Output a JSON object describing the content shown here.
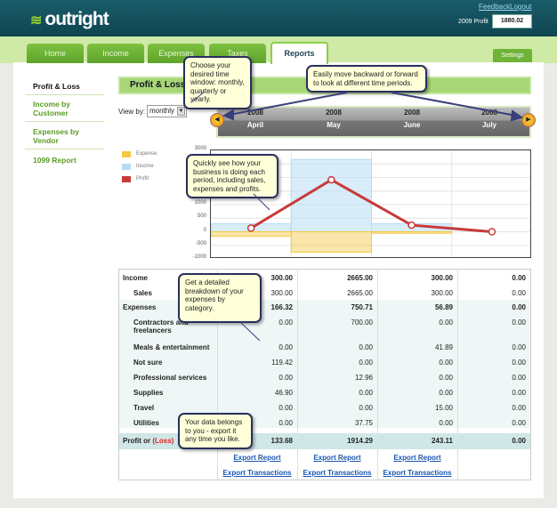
{
  "header": {
    "logo": "outright",
    "feedback": "Feedback",
    "logout": "Logout",
    "profit_label": "2009 Profit",
    "profit_value": "1880.02"
  },
  "tabs": [
    "Home",
    "Income",
    "Expenses",
    "Taxes",
    "Reports"
  ],
  "settings": "Settings",
  "sidebar": [
    "Profit & Loss",
    "Income by Customer",
    "Expenses by Vendor",
    "1099 Report"
  ],
  "main": {
    "title": "Profit & Loss",
    "view_by_label": "View by:",
    "view_by_value": "monthly"
  },
  "periods": [
    {
      "year": "2008",
      "month": "April"
    },
    {
      "year": "2008",
      "month": "May"
    },
    {
      "year": "2008",
      "month": "June"
    },
    {
      "year": "2008",
      "month": "July"
    }
  ],
  "chart_data": {
    "type": "bar+line",
    "legend": [
      "Expense",
      "Income",
      "Profit"
    ],
    "categories": [
      "April",
      "May",
      "June",
      "July"
    ],
    "yticks": [
      "3000",
      "2500",
      "2000",
      "1500",
      "1000",
      "500",
      "0",
      "-500",
      "-1000"
    ],
    "ylim": [
      -1000,
      3000
    ],
    "series": [
      {
        "name": "Income",
        "values": [
          300,
          2665,
          300,
          0
        ]
      },
      {
        "name": "Expense",
        "values": [
          -166.32,
          -750.71,
          -56.89,
          0
        ]
      },
      {
        "name": "Profit",
        "values": [
          133.68,
          1914.29,
          243.11,
          0
        ]
      }
    ],
    "colors": {
      "Expense": "#f5c842",
      "Income": "#b8dcf5",
      "Profit": "#c83a3a"
    }
  },
  "table": {
    "rows": [
      {
        "label": "Income",
        "values": [
          "300.00",
          "2665.00",
          "300.00",
          "0.00"
        ],
        "type": "head"
      },
      {
        "label": "Sales",
        "values": [
          "300.00",
          "2665.00",
          "300.00",
          "0.00"
        ],
        "type": "sub"
      },
      {
        "label": "Expenses",
        "values": [
          "166.32",
          "750.71",
          "56.89",
          "0.00"
        ],
        "type": "head"
      },
      {
        "label": "Contractors and freelancers",
        "values": [
          "0.00",
          "700.00",
          "0.00",
          "0.00"
        ],
        "type": "sub"
      },
      {
        "label": "Meals & entertainment",
        "values": [
          "0.00",
          "0.00",
          "41.89",
          "0.00"
        ],
        "type": "sub"
      },
      {
        "label": "Not sure",
        "values": [
          "119.42",
          "0.00",
          "0.00",
          "0.00"
        ],
        "type": "sub"
      },
      {
        "label": "Professional services",
        "values": [
          "0.00",
          "12.96",
          "0.00",
          "0.00"
        ],
        "type": "sub"
      },
      {
        "label": "Supplies",
        "values": [
          "46.90",
          "0.00",
          "0.00",
          "0.00"
        ],
        "type": "sub"
      },
      {
        "label": "Travel",
        "values": [
          "0.00",
          "0.00",
          "15.00",
          "0.00"
        ],
        "type": "sub"
      },
      {
        "label": "Utilities",
        "values": [
          "0.00",
          "37.75",
          "0.00",
          "0.00"
        ],
        "type": "sub"
      }
    ],
    "profit_label": "Profit or",
    "loss_label": "(Loss)",
    "profit_values": [
      "133.68",
      "1914.29",
      "243.11",
      "0.00"
    ],
    "export_report": "Export Report",
    "export_transactions": "Export Transactions"
  },
  "callouts": [
    "Choose your desired time window: monthly, quarterly or yearly.",
    "Easily move backward or forward to look at different time periods.",
    "Quickly see how your business is doing each period, including sales, expenses and profits.",
    "Get a detailed breakdown of your expenses by category.",
    "Your data belongs to you - export it any time you like."
  ]
}
